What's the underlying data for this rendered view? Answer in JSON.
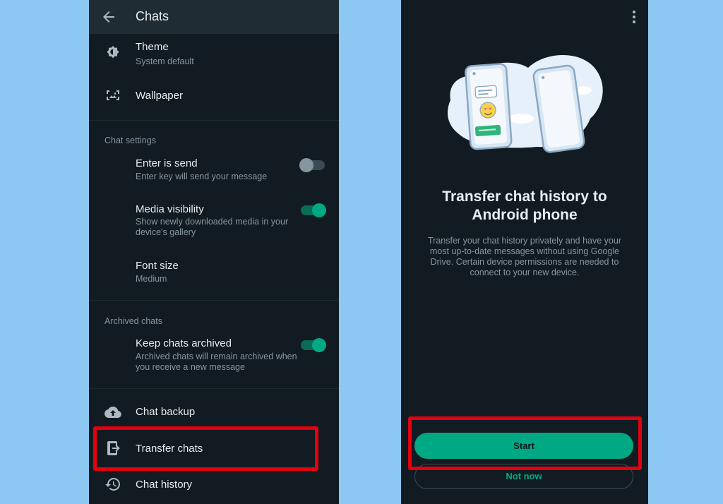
{
  "left": {
    "header": {
      "title": "Chats"
    },
    "display": {
      "theme": {
        "title": "Theme",
        "subtitle": "System default"
      },
      "wallpaper": {
        "title": "Wallpaper"
      }
    },
    "chat_settings": {
      "label": "Chat settings",
      "enter_is_send": {
        "title": "Enter is send",
        "subtitle": "Enter key will send your message",
        "enabled": false
      },
      "media_visibility": {
        "title": "Media visibility",
        "subtitle": "Show newly downloaded media in your device's gallery",
        "enabled": true
      },
      "font_size": {
        "title": "Font size",
        "subtitle": "Medium"
      }
    },
    "archived_chats": {
      "label": "Archived chats",
      "keep_archived": {
        "title": "Keep chats archived",
        "subtitle": "Archived chats will remain archived when you receive a new message",
        "enabled": true
      }
    },
    "bottom": {
      "chat_backup": "Chat backup",
      "transfer_chats": "Transfer chats",
      "chat_history": "Chat history"
    }
  },
  "right": {
    "heading": "Transfer chat history to Android phone",
    "description": "Transfer your chat history privately and have your most up-to-date messages without using Google Drive. Certain device permissions are needed to connect to your new device.",
    "start_label": "Start",
    "not_now_label": "Not now"
  },
  "colors": {
    "background": "#8cc8f2",
    "panel": "#121b22",
    "accent": "#00a884",
    "highlight": "#e3000f"
  }
}
